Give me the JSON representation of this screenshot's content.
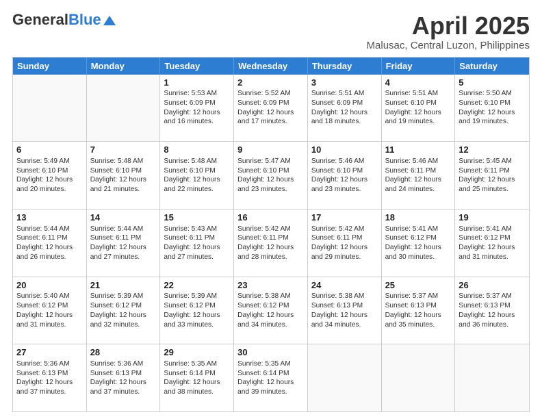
{
  "header": {
    "logo_general": "General",
    "logo_blue": "Blue",
    "title": "April 2025",
    "subtitle": "Malusac, Central Luzon, Philippines"
  },
  "days": [
    "Sunday",
    "Monday",
    "Tuesday",
    "Wednesday",
    "Thursday",
    "Friday",
    "Saturday"
  ],
  "weeks": [
    [
      {
        "day": "",
        "empty": true
      },
      {
        "day": "",
        "empty": true
      },
      {
        "day": "1",
        "sunrise": "Sunrise: 5:53 AM",
        "sunset": "Sunset: 6:09 PM",
        "daylight": "Daylight: 12 hours and 16 minutes."
      },
      {
        "day": "2",
        "sunrise": "Sunrise: 5:52 AM",
        "sunset": "Sunset: 6:09 PM",
        "daylight": "Daylight: 12 hours and 17 minutes."
      },
      {
        "day": "3",
        "sunrise": "Sunrise: 5:51 AM",
        "sunset": "Sunset: 6:09 PM",
        "daylight": "Daylight: 12 hours and 18 minutes."
      },
      {
        "day": "4",
        "sunrise": "Sunrise: 5:51 AM",
        "sunset": "Sunset: 6:10 PM",
        "daylight": "Daylight: 12 hours and 19 minutes."
      },
      {
        "day": "5",
        "sunrise": "Sunrise: 5:50 AM",
        "sunset": "Sunset: 6:10 PM",
        "daylight": "Daylight: 12 hours and 19 minutes."
      }
    ],
    [
      {
        "day": "6",
        "sunrise": "Sunrise: 5:49 AM",
        "sunset": "Sunset: 6:10 PM",
        "daylight": "Daylight: 12 hours and 20 minutes."
      },
      {
        "day": "7",
        "sunrise": "Sunrise: 5:48 AM",
        "sunset": "Sunset: 6:10 PM",
        "daylight": "Daylight: 12 hours and 21 minutes."
      },
      {
        "day": "8",
        "sunrise": "Sunrise: 5:48 AM",
        "sunset": "Sunset: 6:10 PM",
        "daylight": "Daylight: 12 hours and 22 minutes."
      },
      {
        "day": "9",
        "sunrise": "Sunrise: 5:47 AM",
        "sunset": "Sunset: 6:10 PM",
        "daylight": "Daylight: 12 hours and 23 minutes."
      },
      {
        "day": "10",
        "sunrise": "Sunrise: 5:46 AM",
        "sunset": "Sunset: 6:10 PM",
        "daylight": "Daylight: 12 hours and 23 minutes."
      },
      {
        "day": "11",
        "sunrise": "Sunrise: 5:46 AM",
        "sunset": "Sunset: 6:11 PM",
        "daylight": "Daylight: 12 hours and 24 minutes."
      },
      {
        "day": "12",
        "sunrise": "Sunrise: 5:45 AM",
        "sunset": "Sunset: 6:11 PM",
        "daylight": "Daylight: 12 hours and 25 minutes."
      }
    ],
    [
      {
        "day": "13",
        "sunrise": "Sunrise: 5:44 AM",
        "sunset": "Sunset: 6:11 PM",
        "daylight": "Daylight: 12 hours and 26 minutes."
      },
      {
        "day": "14",
        "sunrise": "Sunrise: 5:44 AM",
        "sunset": "Sunset: 6:11 PM",
        "daylight": "Daylight: 12 hours and 27 minutes."
      },
      {
        "day": "15",
        "sunrise": "Sunrise: 5:43 AM",
        "sunset": "Sunset: 6:11 PM",
        "daylight": "Daylight: 12 hours and 27 minutes."
      },
      {
        "day": "16",
        "sunrise": "Sunrise: 5:42 AM",
        "sunset": "Sunset: 6:11 PM",
        "daylight": "Daylight: 12 hours and 28 minutes."
      },
      {
        "day": "17",
        "sunrise": "Sunrise: 5:42 AM",
        "sunset": "Sunset: 6:11 PM",
        "daylight": "Daylight: 12 hours and 29 minutes."
      },
      {
        "day": "18",
        "sunrise": "Sunrise: 5:41 AM",
        "sunset": "Sunset: 6:12 PM",
        "daylight": "Daylight: 12 hours and 30 minutes."
      },
      {
        "day": "19",
        "sunrise": "Sunrise: 5:41 AM",
        "sunset": "Sunset: 6:12 PM",
        "daylight": "Daylight: 12 hours and 31 minutes."
      }
    ],
    [
      {
        "day": "20",
        "sunrise": "Sunrise: 5:40 AM",
        "sunset": "Sunset: 6:12 PM",
        "daylight": "Daylight: 12 hours and 31 minutes."
      },
      {
        "day": "21",
        "sunrise": "Sunrise: 5:39 AM",
        "sunset": "Sunset: 6:12 PM",
        "daylight": "Daylight: 12 hours and 32 minutes."
      },
      {
        "day": "22",
        "sunrise": "Sunrise: 5:39 AM",
        "sunset": "Sunset: 6:12 PM",
        "daylight": "Daylight: 12 hours and 33 minutes."
      },
      {
        "day": "23",
        "sunrise": "Sunrise: 5:38 AM",
        "sunset": "Sunset: 6:12 PM",
        "daylight": "Daylight: 12 hours and 34 minutes."
      },
      {
        "day": "24",
        "sunrise": "Sunrise: 5:38 AM",
        "sunset": "Sunset: 6:13 PM",
        "daylight": "Daylight: 12 hours and 34 minutes."
      },
      {
        "day": "25",
        "sunrise": "Sunrise: 5:37 AM",
        "sunset": "Sunset: 6:13 PM",
        "daylight": "Daylight: 12 hours and 35 minutes."
      },
      {
        "day": "26",
        "sunrise": "Sunrise: 5:37 AM",
        "sunset": "Sunset: 6:13 PM",
        "daylight": "Daylight: 12 hours and 36 minutes."
      }
    ],
    [
      {
        "day": "27",
        "sunrise": "Sunrise: 5:36 AM",
        "sunset": "Sunset: 6:13 PM",
        "daylight": "Daylight: 12 hours and 37 minutes."
      },
      {
        "day": "28",
        "sunrise": "Sunrise: 5:36 AM",
        "sunset": "Sunset: 6:13 PM",
        "daylight": "Daylight: 12 hours and 37 minutes."
      },
      {
        "day": "29",
        "sunrise": "Sunrise: 5:35 AM",
        "sunset": "Sunset: 6:14 PM",
        "daylight": "Daylight: 12 hours and 38 minutes."
      },
      {
        "day": "30",
        "sunrise": "Sunrise: 5:35 AM",
        "sunset": "Sunset: 6:14 PM",
        "daylight": "Daylight: 12 hours and 39 minutes."
      },
      {
        "day": "",
        "empty": true
      },
      {
        "day": "",
        "empty": true
      },
      {
        "day": "",
        "empty": true
      }
    ]
  ]
}
